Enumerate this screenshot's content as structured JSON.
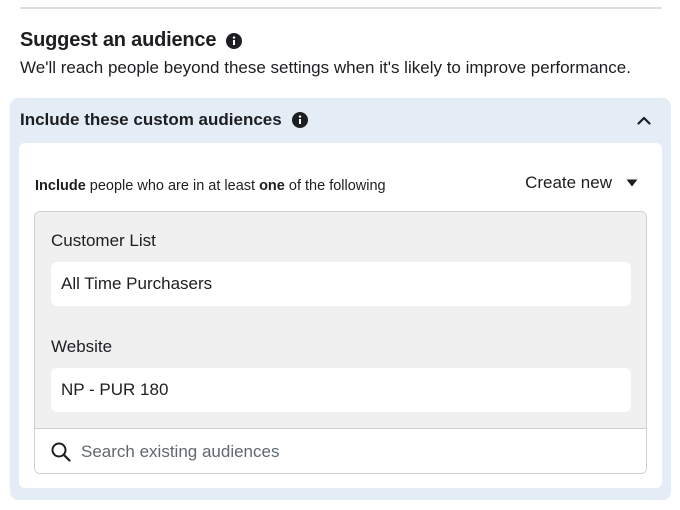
{
  "suggest": {
    "title": "Suggest an audience",
    "subtitle": "We'll reach people beyond these settings when it's likely to improve performance."
  },
  "custom_audiences": {
    "header": "Include these custom audiences",
    "include_line": {
      "part1": "Include",
      "part2": " people who are in at least ",
      "part3": "one",
      "part4": " of the following"
    },
    "create_new_label": "Create new",
    "groups": [
      {
        "label": "Customer List",
        "item": "All Time Purchasers"
      },
      {
        "label": "Website",
        "item": "NP - PUR 180"
      }
    ],
    "search": {
      "placeholder": "Search existing audiences",
      "value": ""
    }
  },
  "icons": {
    "info": "info-icon",
    "collapse": "chevron-up-icon",
    "dropdown": "caret-down-icon",
    "search": "search-icon"
  },
  "colors": {
    "panel_bg": "#e4ecf6",
    "list_bg": "#f0f0f0",
    "text": "#1c1e21",
    "placeholder": "#606770"
  }
}
